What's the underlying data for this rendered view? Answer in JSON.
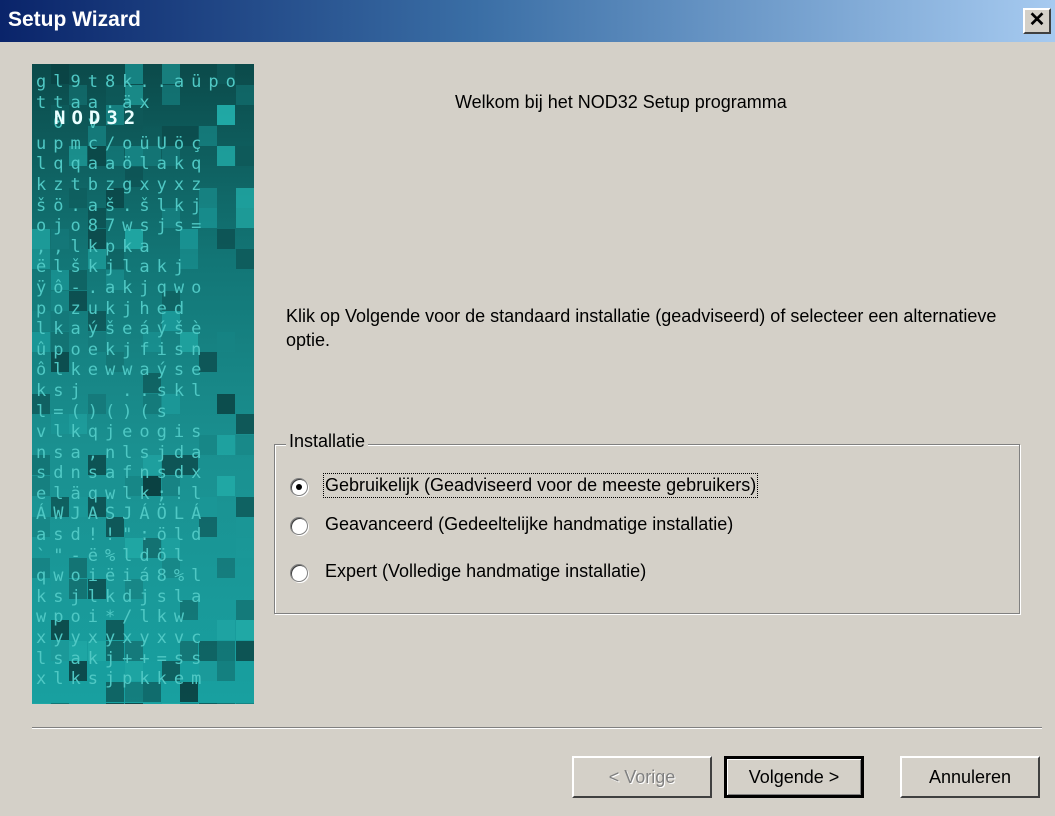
{
  "window": {
    "title": "Setup Wizard",
    "close_glyph": "✕"
  },
  "banner": {
    "logo_text": "NOD32",
    "glyph_rows": [
      "gl9t8k..aüpo",
      "ttaa.äx",
      " 0 v",
      "upmc/oüUöç",
      "lqqaaölakq",
      "kztbzgxyxz",
      "šö.aš.šlkj",
      "ojo87wsjs=",
      ",,lkpka",
      "ëlškjlakj",
      "ÿô-.akjqwo",
      "pozukjhed",
      "lkaýšeáýšè",
      "ûpoekjfisn",
      "ôlkewwaýse",
      "ksj  ..skl",
      "l=()()(s",
      "vlkqjeogis",
      "nsa,nlsjda",
      "sdnsafnsdx",
      "eläqwlk;!l",
      "ÁWJASJÁÖLÁ",
      "asd!!\":öld",
      "`\"-ë%ldöl",
      "qwoiëiá8%l",
      "ksjlkdjsla",
      "wpoi*/lkw",
      "xyyxyxyxvc",
      "lsakj++=ss",
      "xlksjpkkem"
    ]
  },
  "content": {
    "welcome": "Welkom bij het NOD32 Setup programma",
    "intro": "Klik op Volgende voor de standaard installatie (geadviseerd) of selecteer een alternatieve optie.",
    "group_label": "Installatie",
    "options": [
      {
        "label": "Gebruikelijk (Geadviseerd voor de meeste gebruikers)",
        "selected": true
      },
      {
        "label": "Geavanceerd (Gedeeltelijke handmatige installatie)",
        "selected": false
      },
      {
        "label": "Expert (Volledige handmatige installatie)",
        "selected": false
      }
    ]
  },
  "buttons": {
    "back": "< Vorige",
    "next": "Volgende >",
    "cancel": "Annuleren"
  },
  "colors": {
    "face": "#d4d0c8",
    "title_start": "#0a246a",
    "title_end": "#a6caf0",
    "banner_teal": "#127575"
  }
}
